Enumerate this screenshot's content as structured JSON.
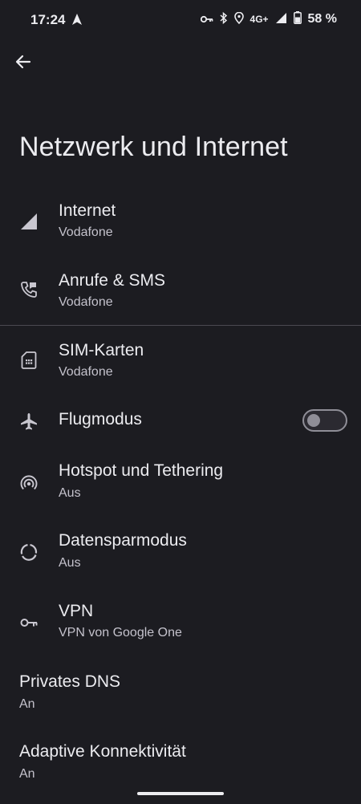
{
  "status_bar": {
    "time": "17:24",
    "network": "4G+",
    "battery": "58 %",
    "icons": [
      "navigation-icon",
      "vpn-key-icon",
      "bluetooth-icon",
      "location-icon",
      "signal-icon",
      "battery-icon"
    ]
  },
  "header": {
    "back_icon": "arrow-back-icon",
    "title": "Netzwerk und Internet"
  },
  "items": [
    {
      "title": "Internet",
      "subtitle": "Vodafone",
      "icon": "cell-signal-icon"
    },
    {
      "title": "Anrufe & SMS",
      "subtitle": "Vodafone",
      "icon": "phone-sms-icon"
    },
    {
      "title": "SIM-Karten",
      "subtitle": "Vodafone",
      "icon": "sim-card-icon"
    },
    {
      "title": "Flugmodus",
      "icon": "airplane-icon",
      "toggle_on": false
    },
    {
      "title": "Hotspot und Tethering",
      "subtitle": "Aus",
      "icon": "hotspot-icon"
    },
    {
      "title": "Datensparmodus",
      "subtitle": "Aus",
      "icon": "data-saver-icon"
    },
    {
      "title": "VPN",
      "subtitle": "VPN von Google One",
      "icon": "vpn-key-icon"
    },
    {
      "title": "Privates DNS",
      "subtitle": "An"
    },
    {
      "title": "Adaptive Konnektivität",
      "subtitle": "An"
    }
  ],
  "colors": {
    "background": "#1c1c21",
    "text_primary": "#ececf0",
    "text_secondary": "#c4c2cc",
    "divider": "#4a4950",
    "toggle_off": "#8f8e97"
  }
}
